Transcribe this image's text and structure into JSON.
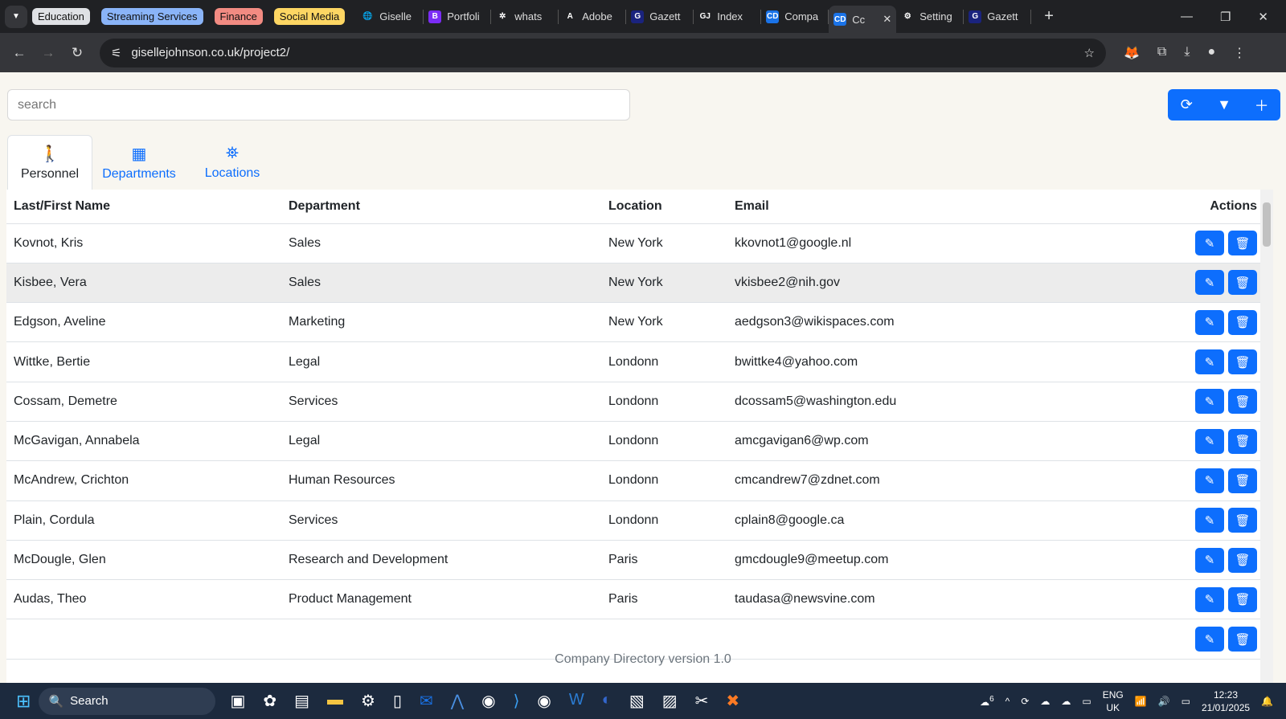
{
  "browser": {
    "groups": [
      {
        "label": "Education",
        "color": "#dfe1e5"
      },
      {
        "label": "Streaming Services",
        "color": "#8ab4f8"
      },
      {
        "label": "Finance",
        "color": "#f28b82"
      },
      {
        "label": "Social Media",
        "color": "#fdd663"
      }
    ],
    "tabs": [
      {
        "title": "Giselle",
        "fav": "🌐"
      },
      {
        "title": "Portfoli",
        "fav": "B"
      },
      {
        "title": "whats",
        "fav": "✲"
      },
      {
        "title": "Adobe",
        "fav": "A"
      },
      {
        "title": "Gazett",
        "fav": "G"
      },
      {
        "title": "Index",
        "fav": "GJ"
      },
      {
        "title": "Compa",
        "fav": "CD"
      },
      {
        "title": "Cc",
        "fav": "CD",
        "active": true
      },
      {
        "title": "Setting",
        "fav": "⚙"
      },
      {
        "title": "Gazett",
        "fav": "G"
      }
    ],
    "url": "gisellejohnson.co.uk/project2/"
  },
  "app": {
    "search_placeholder": "search",
    "tabs": [
      {
        "label": "Personnel",
        "icon": "person-icon"
      },
      {
        "label": "Departments",
        "icon": "building-icon"
      },
      {
        "label": "Locations",
        "icon": "map-icon"
      }
    ],
    "columns": [
      "Last/First Name",
      "Department",
      "Location",
      "Email",
      "Actions"
    ],
    "rows": [
      [
        "Kovnot, Kris",
        "Sales",
        "New York",
        "kkovnot1@google.nl"
      ],
      [
        "Kisbee, Vera",
        "Sales",
        "New York",
        "vkisbee2@nih.gov"
      ],
      [
        "Edgson, Aveline",
        "Marketing",
        "New York",
        "aedgson3@wikispaces.com"
      ],
      [
        "Wittke, Bertie",
        "Legal",
        "Londonn",
        "bwittke4@yahoo.com"
      ],
      [
        "Cossam, Demetre",
        "Services",
        "Londonn",
        "dcossam5@washington.edu"
      ],
      [
        "McGavigan, Annabela",
        "Legal",
        "Londonn",
        "amcgavigan6@wp.com"
      ],
      [
        "McAndrew, Crichton",
        "Human Resources",
        "Londonn",
        "cmcandrew7@zdnet.com"
      ],
      [
        "Plain, Cordula",
        "Services",
        "Londonn",
        "cplain8@google.ca"
      ],
      [
        "McDougle, Glen",
        "Research and Development",
        "Paris",
        "gmcdougle9@meetup.com"
      ],
      [
        "Audas, Theo",
        "Product Management",
        "Paris",
        "taudasa@newsvine.com"
      ]
    ],
    "footer": "Company Directory version 1.0",
    "accent": "#0d6efd"
  },
  "taskbar": {
    "search": "Search",
    "lang": "ENG",
    "region": "UK",
    "time": "12:23",
    "date": "21/01/2025",
    "weather_badge": "6"
  }
}
